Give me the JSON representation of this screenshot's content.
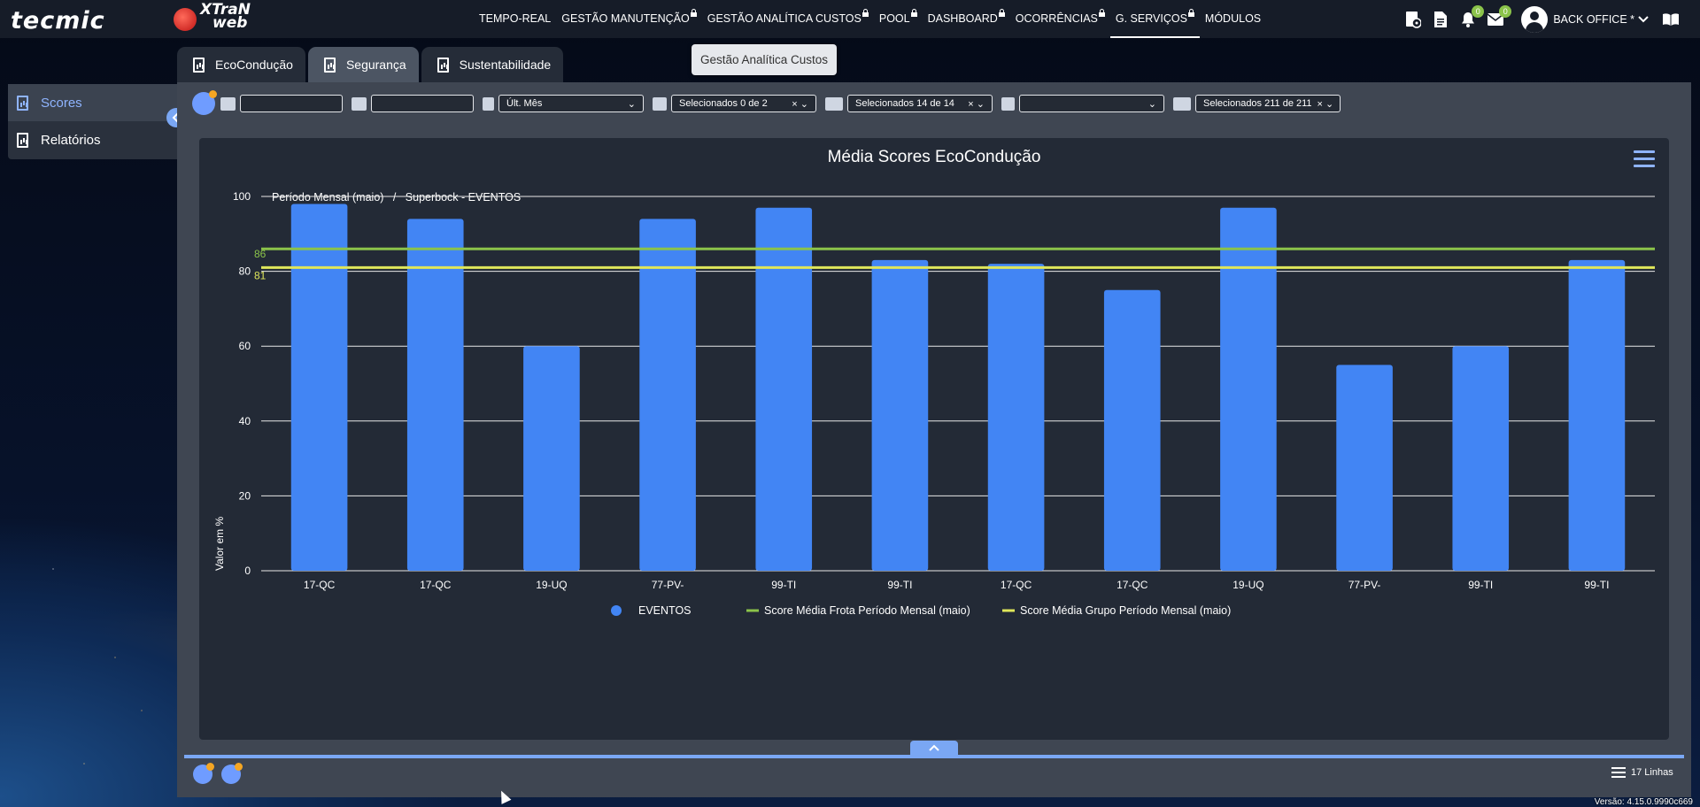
{
  "brand": {
    "logo_primary": "tecmic",
    "logo_secondary_line1": "XTraN",
    "logo_secondary_line2": "web"
  },
  "nav": {
    "items": [
      {
        "label": "TEMPO-REAL",
        "locked": false
      },
      {
        "label": "GESTÃO MANUTENÇÃO",
        "locked": true
      },
      {
        "label": "GESTÃO ANALÍTICA CUSTOS",
        "locked": true
      },
      {
        "label": "POOL",
        "locked": true
      },
      {
        "label": "DASHBOARD",
        "locked": true
      },
      {
        "label": "OCORRÊNCIAS",
        "locked": true
      },
      {
        "label": "G. SERVIÇOS",
        "locked": true,
        "active": true
      },
      {
        "label": "MÓDULOS",
        "locked": false
      }
    ],
    "tooltip": "Gestão Analítica Custos"
  },
  "header_right": {
    "notifications_count": "0",
    "messages_count": "0",
    "user_name": "BACK OFFICE *",
    "icons": [
      "steering-document-icon",
      "document-icon",
      "bell-icon",
      "envelope-icon",
      "user-avatar-icon",
      "book-icon"
    ]
  },
  "tabs": [
    {
      "label": "EcoCondução",
      "active": false
    },
    {
      "label": "Segurança",
      "active": true
    },
    {
      "label": "Sustentabilidade",
      "active": false
    }
  ],
  "sidebar": {
    "items": [
      {
        "label": "Scores",
        "active": true
      },
      {
        "label": "Relatórios",
        "active": false
      }
    ]
  },
  "filters": {
    "date_from": "",
    "date_to": "",
    "period": "Últ. Mês",
    "clients": "Selecionados 0 de 2",
    "groups": "Selecionados 14 de 14",
    "layout": "",
    "vehicles": "Selecionados 211 de 211",
    "clear_symbol": "×",
    "chevron": "⌄"
  },
  "chart_data": {
    "type": "bar",
    "title": "Média Scores EcoCondução",
    "subtitle_period": "Período Mensal (maio)",
    "subtitle_separator": "/",
    "subtitle_context": "Superbock - EVENTOS",
    "ylabel": "Valor em %",
    "ylim": [
      0,
      100
    ],
    "yticks": [
      0,
      20,
      40,
      60,
      80,
      100
    ],
    "categories": [
      "17-QC",
      "17-QC",
      "19-UQ",
      "77-PV-",
      "99-TI",
      "99-TI",
      "17-QC",
      "17-QC",
      "19-UQ",
      "77-PV-",
      "99-TI",
      "99-TI"
    ],
    "series": [
      {
        "name": "EVENTOS",
        "values": [
          98,
          94,
          60,
          94,
          97,
          83,
          82,
          75,
          97,
          55,
          60,
          83
        ],
        "color": "#4285f4"
      }
    ],
    "reference_lines": [
      {
        "name": "Score Média Frota Período Mensal (maio)",
        "value": 86,
        "label": "86",
        "color": "#8bc34a"
      },
      {
        "name": "Score Média Grupo Período Mensal (maio)",
        "value": 81,
        "label": "81",
        "color": "#dfe65a"
      }
    ],
    "grid": true,
    "legend_position": "bottom-center"
  },
  "footer": {
    "expand_symbol": "^",
    "lines_count": "17 Linhas",
    "version": "Versão: 4.15.0.9990c669"
  }
}
